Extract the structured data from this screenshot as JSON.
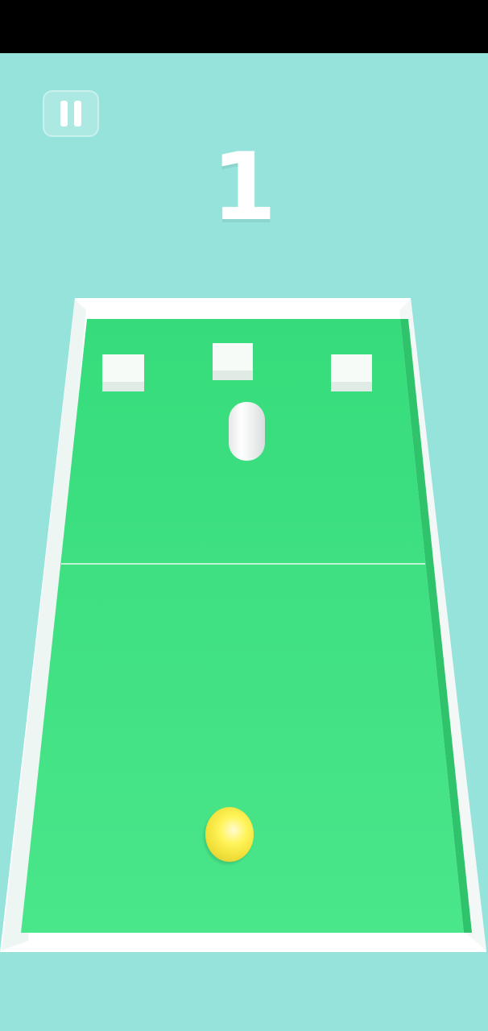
{
  "hud": {
    "score": "1",
    "pause_icon": "pause-icon"
  },
  "scene": {
    "court_color": "#3ae07e",
    "frame_color": "#ffffff",
    "background_color": "#95e3db",
    "ball_color": "#fff45a",
    "block_count": 3,
    "has_paddle": true
  }
}
